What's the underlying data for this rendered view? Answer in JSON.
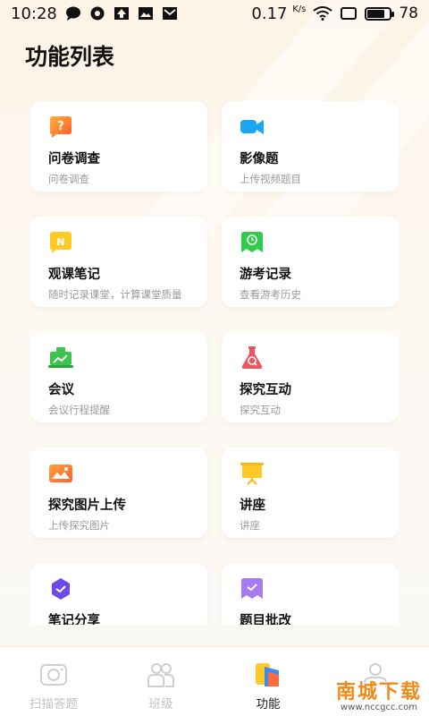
{
  "status_bar": {
    "time": "10:28",
    "speed": "0.17",
    "speed_unit": "K/s",
    "battery": "78",
    "battery_level": 0.78
  },
  "page": {
    "title": "功能列表"
  },
  "cards": [
    {
      "title": "问卷调查",
      "subtitle": "问卷调查",
      "icon": "question-icon"
    },
    {
      "title": "影像题",
      "subtitle": "上传视频题目",
      "icon": "video-camera-icon"
    },
    {
      "title": "观课笔记",
      "subtitle": "随时记录课堂，计算课堂质量",
      "icon": "notes-icon"
    },
    {
      "title": "游考记录",
      "subtitle": "查看游考历史",
      "icon": "record-icon"
    },
    {
      "title": "会议",
      "subtitle": "会议行程提醒",
      "icon": "meeting-icon"
    },
    {
      "title": "探究互动",
      "subtitle": "探究互动",
      "icon": "flask-icon"
    },
    {
      "title": "探究图片上传",
      "subtitle": "上传探究图片",
      "icon": "image-icon"
    },
    {
      "title": "讲座",
      "subtitle": "讲座",
      "icon": "presentation-board-icon"
    },
    {
      "title": "笔记分享",
      "subtitle": "",
      "icon": "share-notes-icon"
    },
    {
      "title": "题目批改",
      "subtitle": "",
      "icon": "grading-icon"
    }
  ],
  "nav": [
    {
      "label": "扫描答题",
      "icon": "camera-scan-icon",
      "active": false
    },
    {
      "label": "班级",
      "icon": "people-icon",
      "active": false
    },
    {
      "label": "功能",
      "icon": "functions-icon",
      "active": true
    },
    {
      "label": "",
      "icon": "user-icon",
      "active": false
    }
  ],
  "watermark": {
    "text": "南城下载",
    "url": "www.nccgcc.com"
  },
  "colors": {
    "background": "#fdf7ef",
    "card": "#ffffff",
    "accent_orange": "#f08a1c",
    "inactive_nav": "#c2c2c2"
  }
}
